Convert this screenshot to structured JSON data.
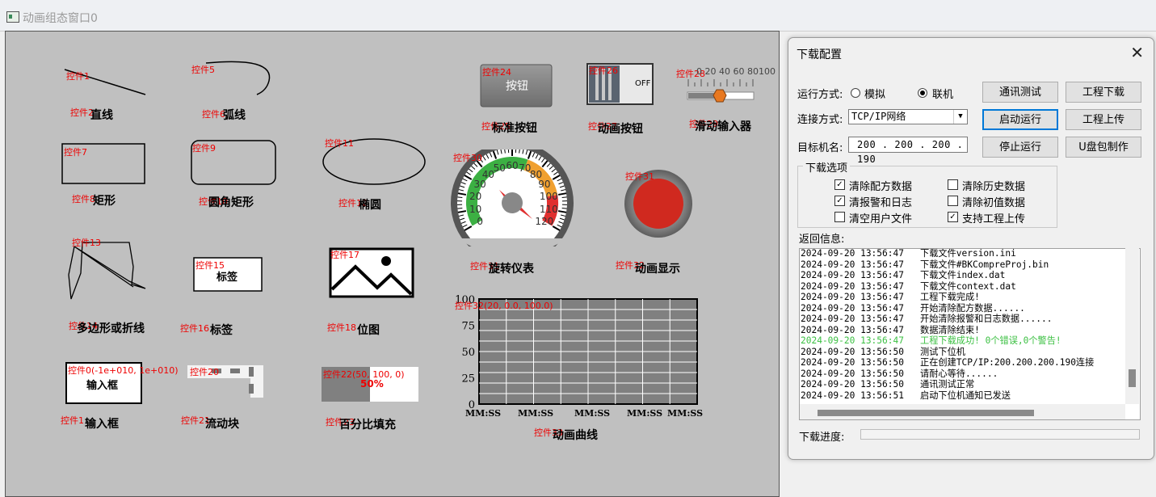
{
  "window": {
    "title": "动画组态窗口0"
  },
  "canvas": {
    "widgets": [
      {
        "id": "ctl-1",
        "label": "控件1",
        "caption": "直线"
      },
      {
        "id": "ctl-2",
        "label": "控件2",
        "caption": "直线"
      },
      {
        "id": "ctl-5",
        "label": "控件5",
        "caption": "弧线"
      },
      {
        "id": "ctl-6",
        "label": "控件6",
        "caption": "弧线"
      },
      {
        "id": "ctl-7",
        "label": "控件7",
        "caption": "矩形"
      },
      {
        "id": "ctl-8",
        "label": "控件8",
        "caption": "矩形"
      },
      {
        "id": "ctl-9",
        "label": "控件9",
        "caption": "圆角矩形"
      },
      {
        "id": "ctl-10",
        "label": "控件10",
        "caption": "圆角矩形"
      },
      {
        "id": "ctl-11",
        "label": "控件11",
        "caption": "椭圆"
      },
      {
        "id": "ctl-12",
        "label": "控件12",
        "caption": "椭圆"
      },
      {
        "id": "ctl-13",
        "label": "控件13",
        "caption": "多边形或折线"
      },
      {
        "id": "ctl-14",
        "label": "控件14",
        "caption": "多边形或折线"
      },
      {
        "id": "ctl-15",
        "label": "控件15",
        "caption": "标签"
      },
      {
        "id": "ctl-16",
        "label": "控件16",
        "caption": "标签"
      },
      {
        "id": "ctl-17",
        "label": "控件17",
        "caption": "位图"
      },
      {
        "id": "ctl-18",
        "label": "控件18",
        "caption": "位图"
      }
    ],
    "line_label": "控件1",
    "line_ctl": "控件2",
    "line_caption": "直线",
    "arc_label": "控件5",
    "arc_ctl": "控件6",
    "arc_caption": "弧线",
    "rect_label": "控件7",
    "rect_ctl": "控件8",
    "rect_caption": "矩形",
    "rrect_label": "控件9",
    "rrect_ctl": "控件10",
    "rrect_caption": "圆角矩形",
    "ellipse_label": "控件11",
    "ellipse_ctl": "控件12",
    "ellipse_caption": "椭圆",
    "poly_label": "控件13",
    "poly_ctl": "控件14",
    "poly_caption": "多边形或折线",
    "tag_label": "控件15",
    "tag_text": "标签",
    "tag_ctl": "控件16",
    "tag_caption": "标签",
    "bitmap_label": "控件17",
    "bitmap_ctl": "控件18",
    "bitmap_caption": "位图",
    "input_label": "控件0(-1e+010, 1e+010)",
    "input_text": "输入框",
    "input_ctl": "控件1",
    "input_caption": "输入框",
    "flow_label": "控件20",
    "flow_ctl": "控件21",
    "flow_caption": "流动块",
    "percent_label": "控件22(50, 100, 0)",
    "percent_value": "50%",
    "percent_fill": 0.5,
    "percent_ctl": "控件23",
    "percent_caption": "百分比填充",
    "std_btn_label": "控件24",
    "std_btn_text": "按钮",
    "std_btn_ctl": "控件25",
    "std_btn_caption": "标准按钮",
    "anim_btn_label": "控件26",
    "anim_btn_text": "OFF",
    "anim_btn_ctl": "控件27",
    "anim_btn_caption": "动画按钮",
    "slider_label": "控件28",
    "slider_ticks": "0 20 40 60 80100",
    "slider_value": 40,
    "slider_ctl": "控件29",
    "slider_caption": "滑动输入器",
    "gauge_label": "控件30",
    "gauge_ctl": "控件31",
    "gauge_caption": "旋转仪表",
    "lamp_label": "控件31",
    "lamp_ctl": "控件32",
    "lamp_caption": "动画显示",
    "trend_label": "控件32(20, 0.0, 100.0)",
    "trend_ctl": "控件33",
    "trend_caption": "动画曲线",
    "colors": {
      "ctl_label": "#e00000",
      "gauge_green": "#3cb043",
      "gauge_orange": "#f0a030",
      "gauge_red": "#e03030",
      "lamp": "#d0291f"
    }
  },
  "chart_data": [
    {
      "type": "gauge",
      "ticks": [
        "0",
        "10",
        "20",
        "30",
        "40",
        "50",
        "60",
        "70",
        "80",
        "90",
        "100",
        "110",
        "120"
      ],
      "range": [
        0,
        120
      ],
      "bands": [
        {
          "from": 0,
          "to": 70,
          "color": "#3cb043"
        },
        {
          "from": 70,
          "to": 100,
          "color": "#f0a030"
        },
        {
          "from": 100,
          "to": 120,
          "color": "#e03030"
        }
      ],
      "value": 30
    },
    {
      "type": "line",
      "title": "",
      "y_ticks": [
        "0",
        "25",
        "50",
        "75",
        "100"
      ],
      "ylim": [
        0,
        100
      ],
      "x_ticks": [
        "MM:SS",
        "MM:SS",
        "MM:SS",
        "MM:SS",
        "MM:SS"
      ],
      "grid": true,
      "series": []
    }
  ],
  "dialog": {
    "title": "下载配置",
    "close": "✕",
    "run_mode_label": "运行方式:",
    "run_mode_sim": "模拟",
    "run_mode_online": "联机",
    "conn_label": "连接方式:",
    "conn_value": "TCP/IP网络",
    "target_label": "目标机名:",
    "target_value": "200 . 200 . 200 . 190",
    "buttons": {
      "comm_test": "通讯测试",
      "project_download": "工程下载",
      "start_run": "启动运行",
      "project_upload": "工程上传",
      "stop_run": "停止运行",
      "usb_pack": "U盘包制作"
    },
    "options_title": "下载选项",
    "options": [
      {
        "label": "清除配方数据",
        "checked": true
      },
      {
        "label": "清除历史数据",
        "checked": false
      },
      {
        "label": "清报警和日志",
        "checked": true
      },
      {
        "label": "清除初值数据",
        "checked": false
      },
      {
        "label": "清空用户文件",
        "checked": false
      },
      {
        "label": "支持工程上传",
        "checked": true
      }
    ],
    "return_label": "返回信息:",
    "log": [
      {
        "time": "2024-09-20 13:56:47",
        "msg": "下载文件version.ini",
        "ok": false
      },
      {
        "time": "2024-09-20 13:56:47",
        "msg": "下载文件#BKCompreProj.bin",
        "ok": false
      },
      {
        "time": "2024-09-20 13:56:47",
        "msg": "下载文件index.dat",
        "ok": false
      },
      {
        "time": "2024-09-20 13:56:47",
        "msg": "下载文件context.dat",
        "ok": false
      },
      {
        "time": "2024-09-20 13:56:47",
        "msg": "工程下载完成!",
        "ok": false
      },
      {
        "time": "2024-09-20 13:56:47",
        "msg": "开始清除配方数据......",
        "ok": false
      },
      {
        "time": "2024-09-20 13:56:47",
        "msg": "开始清除报警和日志数据......",
        "ok": false
      },
      {
        "time": "2024-09-20 13:56:47",
        "msg": "数据清除结束!",
        "ok": false
      },
      {
        "time": "2024-09-20 13:56:47",
        "msg": "工程下载成功! 0个错误,0个警告!",
        "ok": true
      },
      {
        "time": "2024-09-20 13:56:50",
        "msg": "测试下位机",
        "ok": false
      },
      {
        "time": "2024-09-20 13:56:50",
        "msg": "正在创建TCP/IP:200.200.200.190连接",
        "ok": false
      },
      {
        "time": "2024-09-20 13:56:50",
        "msg": "请耐心等待......",
        "ok": false
      },
      {
        "time": "2024-09-20 13:56:50",
        "msg": "通讯测试正常",
        "ok": false
      },
      {
        "time": "2024-09-20 13:56:51",
        "msg": "启动下位机通知已发送",
        "ok": false
      }
    ],
    "progress_label": "下载进度:",
    "progress_value": 0
  }
}
